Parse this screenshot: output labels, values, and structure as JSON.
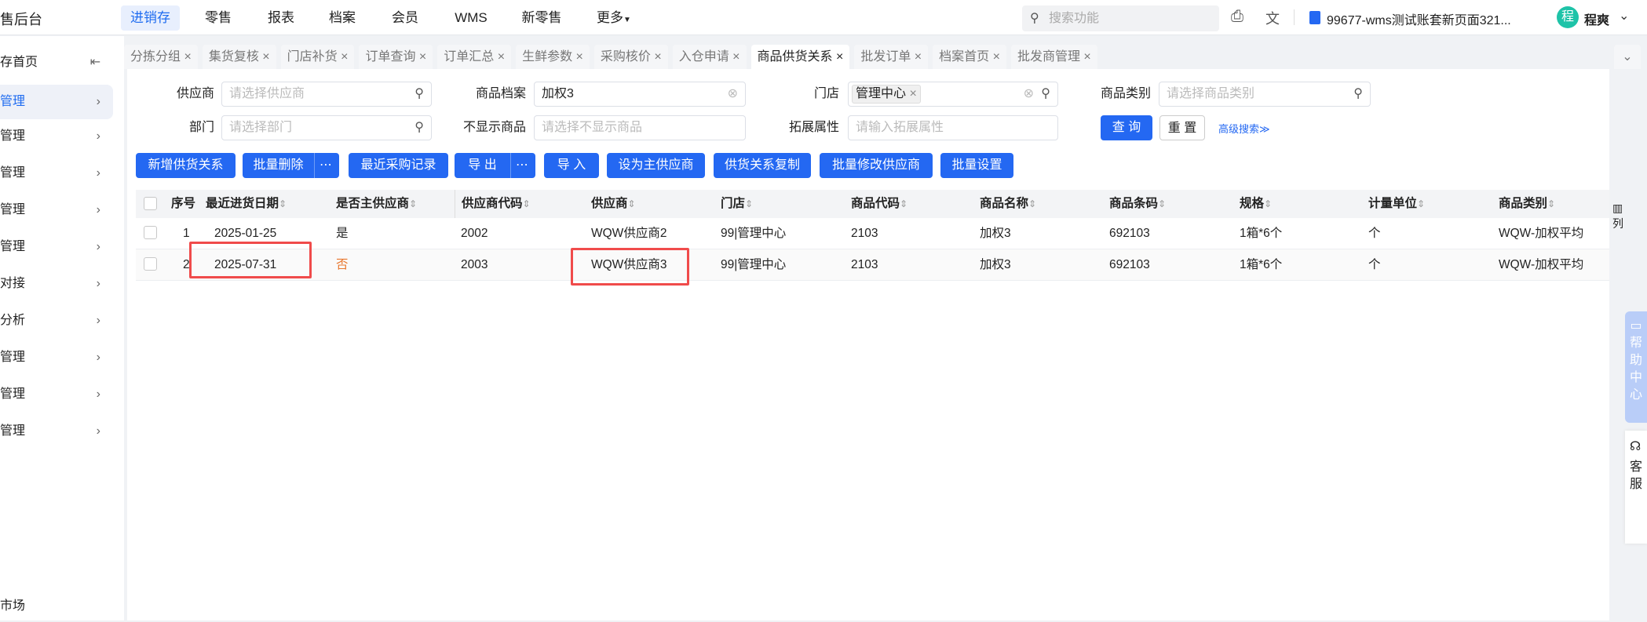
{
  "app": {
    "title": "售后台"
  },
  "topnav": {
    "items": [
      "进销存",
      "零售",
      "报表",
      "档案",
      "会员",
      "WMS",
      "新零售",
      "更多"
    ],
    "active": "进销存",
    "search_placeholder": "搜索功能",
    "account": "99677-wms测试账套新页面321...",
    "avatar_char": "程",
    "user": "程爽"
  },
  "sidebar": {
    "items": [
      "存首页",
      "管理",
      "管理",
      "管理",
      "管理",
      "管理",
      "对接",
      "分析",
      "管理",
      "管理",
      "管理"
    ],
    "footer": "市场"
  },
  "tabs": [
    {
      "label": "分拣分组"
    },
    {
      "label": "集货复核"
    },
    {
      "label": "门店补货"
    },
    {
      "label": "订单查询"
    },
    {
      "label": "订单汇总"
    },
    {
      "label": "生鲜参数"
    },
    {
      "label": "采购核价"
    },
    {
      "label": "入仓申请"
    },
    {
      "label": "商品供货关系",
      "active": true
    },
    {
      "label": "批发订单"
    },
    {
      "label": "档案首页"
    },
    {
      "label": "批发商管理"
    }
  ],
  "filters": {
    "supplier": {
      "label": "供应商",
      "placeholder": "请选择供应商"
    },
    "product": {
      "label": "商品档案",
      "value": "加权3"
    },
    "store": {
      "label": "门店",
      "tag": "管理中心"
    },
    "category": {
      "label": "商品类别",
      "placeholder": "请选择商品类别"
    },
    "dept": {
      "label": "部门",
      "placeholder": "请选择部门"
    },
    "hidden": {
      "label": "不显示商品",
      "placeholder": "请选择不显示商品"
    },
    "ext": {
      "label": "拓展属性",
      "placeholder": "请输入拓展属性"
    },
    "query": "查 询",
    "reset": "重 置",
    "advanced": "高级搜索"
  },
  "toolbar": [
    "新增供货关系",
    "批量删除",
    "最近采购记录",
    "导 出",
    "导 入",
    "设为主供应商",
    "供货关系复制",
    "批量修改供应商",
    "批量设置"
  ],
  "table": {
    "columns": [
      "序号",
      "最近进货日期",
      "是否主供应商",
      "供应商代码",
      "供应商",
      "门店",
      "商品代码",
      "商品名称",
      "商品条码",
      "规格",
      "计量单位",
      "商品类别"
    ],
    "rows": [
      [
        "1",
        "2025-01-25",
        "是",
        "2002",
        "WQW供应商2",
        "99|管理中心",
        "2103",
        "加权3",
        "692103",
        "1箱*6个",
        "个",
        "WQW-加权平均"
      ],
      [
        "2",
        "2025-07-31",
        "否",
        "2003",
        "WQW供应商3",
        "99|管理中心",
        "2103",
        "加权3",
        "692103",
        "1箱*6个",
        "个",
        "WQW-加权平均"
      ]
    ],
    "column_settings": "列"
  },
  "help": {
    "help_center": "帮助中心",
    "customer_service": "客服"
  },
  "colors": {
    "primary": "#2468f2",
    "no_value": "#e8772e",
    "highlight": "#f04b4b"
  }
}
